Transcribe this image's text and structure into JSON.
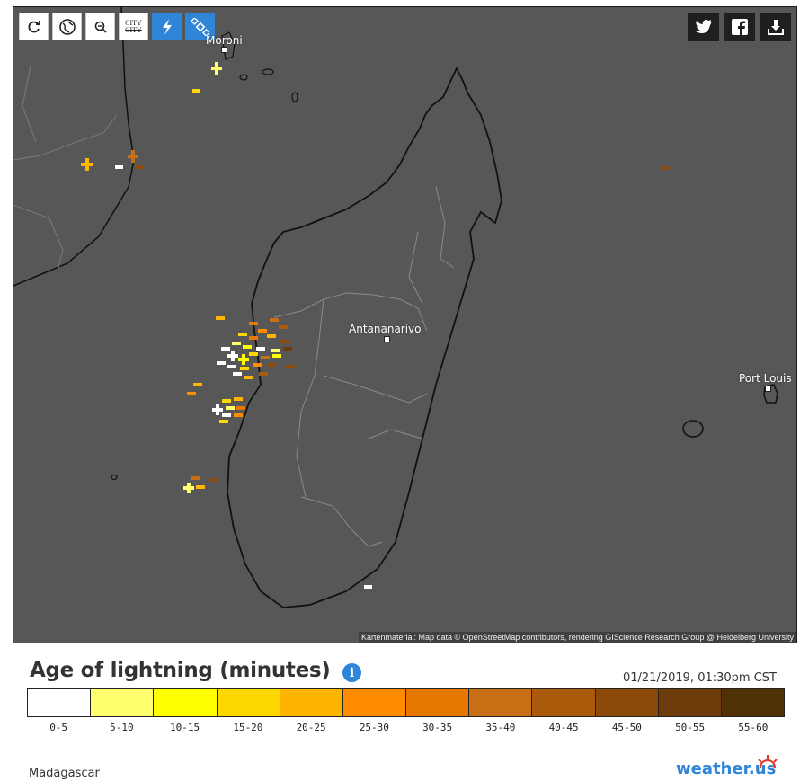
{
  "toolbar": {
    "buttons": [
      {
        "name": "refresh-icon"
      },
      {
        "name": "globe-icon"
      },
      {
        "name": "zoom-out-icon"
      },
      {
        "name": "city-toggle",
        "text_top": "CITY",
        "text_bottom": "CITY"
      },
      {
        "name": "lightning-icon"
      },
      {
        "name": "satellite-icon"
      }
    ]
  },
  "share": [
    {
      "name": "twitter-icon"
    },
    {
      "name": "facebook-icon"
    },
    {
      "name": "download-icon"
    }
  ],
  "map": {
    "cities": {
      "moroni": "Moroni",
      "antananarivo": "Antananarivo",
      "port_louis": "Port Louis"
    },
    "attribution": "Kartenmaterial: Map data © OpenStreetMap contributors, rendering GIScience Research Group @ Heidelberg University"
  },
  "legend": {
    "title": "Age of lightning (minutes)",
    "timestamp": "01/21/2019, 01:30pm CST",
    "scale": [
      {
        "label": "0-5",
        "color": "#ffffff"
      },
      {
        "label": "5-10",
        "color": "#ffff6e"
      },
      {
        "label": "10-15",
        "color": "#ffff00"
      },
      {
        "label": "15-20",
        "color": "#ffd700"
      },
      {
        "label": "20-25",
        "color": "#ffb400"
      },
      {
        "label": "25-30",
        "color": "#ff8c00"
      },
      {
        "label": "30-35",
        "color": "#e67800"
      },
      {
        "label": "35-40",
        "color": "#c86e14"
      },
      {
        "label": "40-45",
        "color": "#aa5a0a"
      },
      {
        "label": "45-50",
        "color": "#8c4a0a"
      },
      {
        "label": "50-55",
        "color": "#6e3c0a"
      },
      {
        "label": "55-60",
        "color": "#503005"
      }
    ]
  },
  "footer": {
    "region": "Madagascar",
    "logo": "weather.us"
  }
}
